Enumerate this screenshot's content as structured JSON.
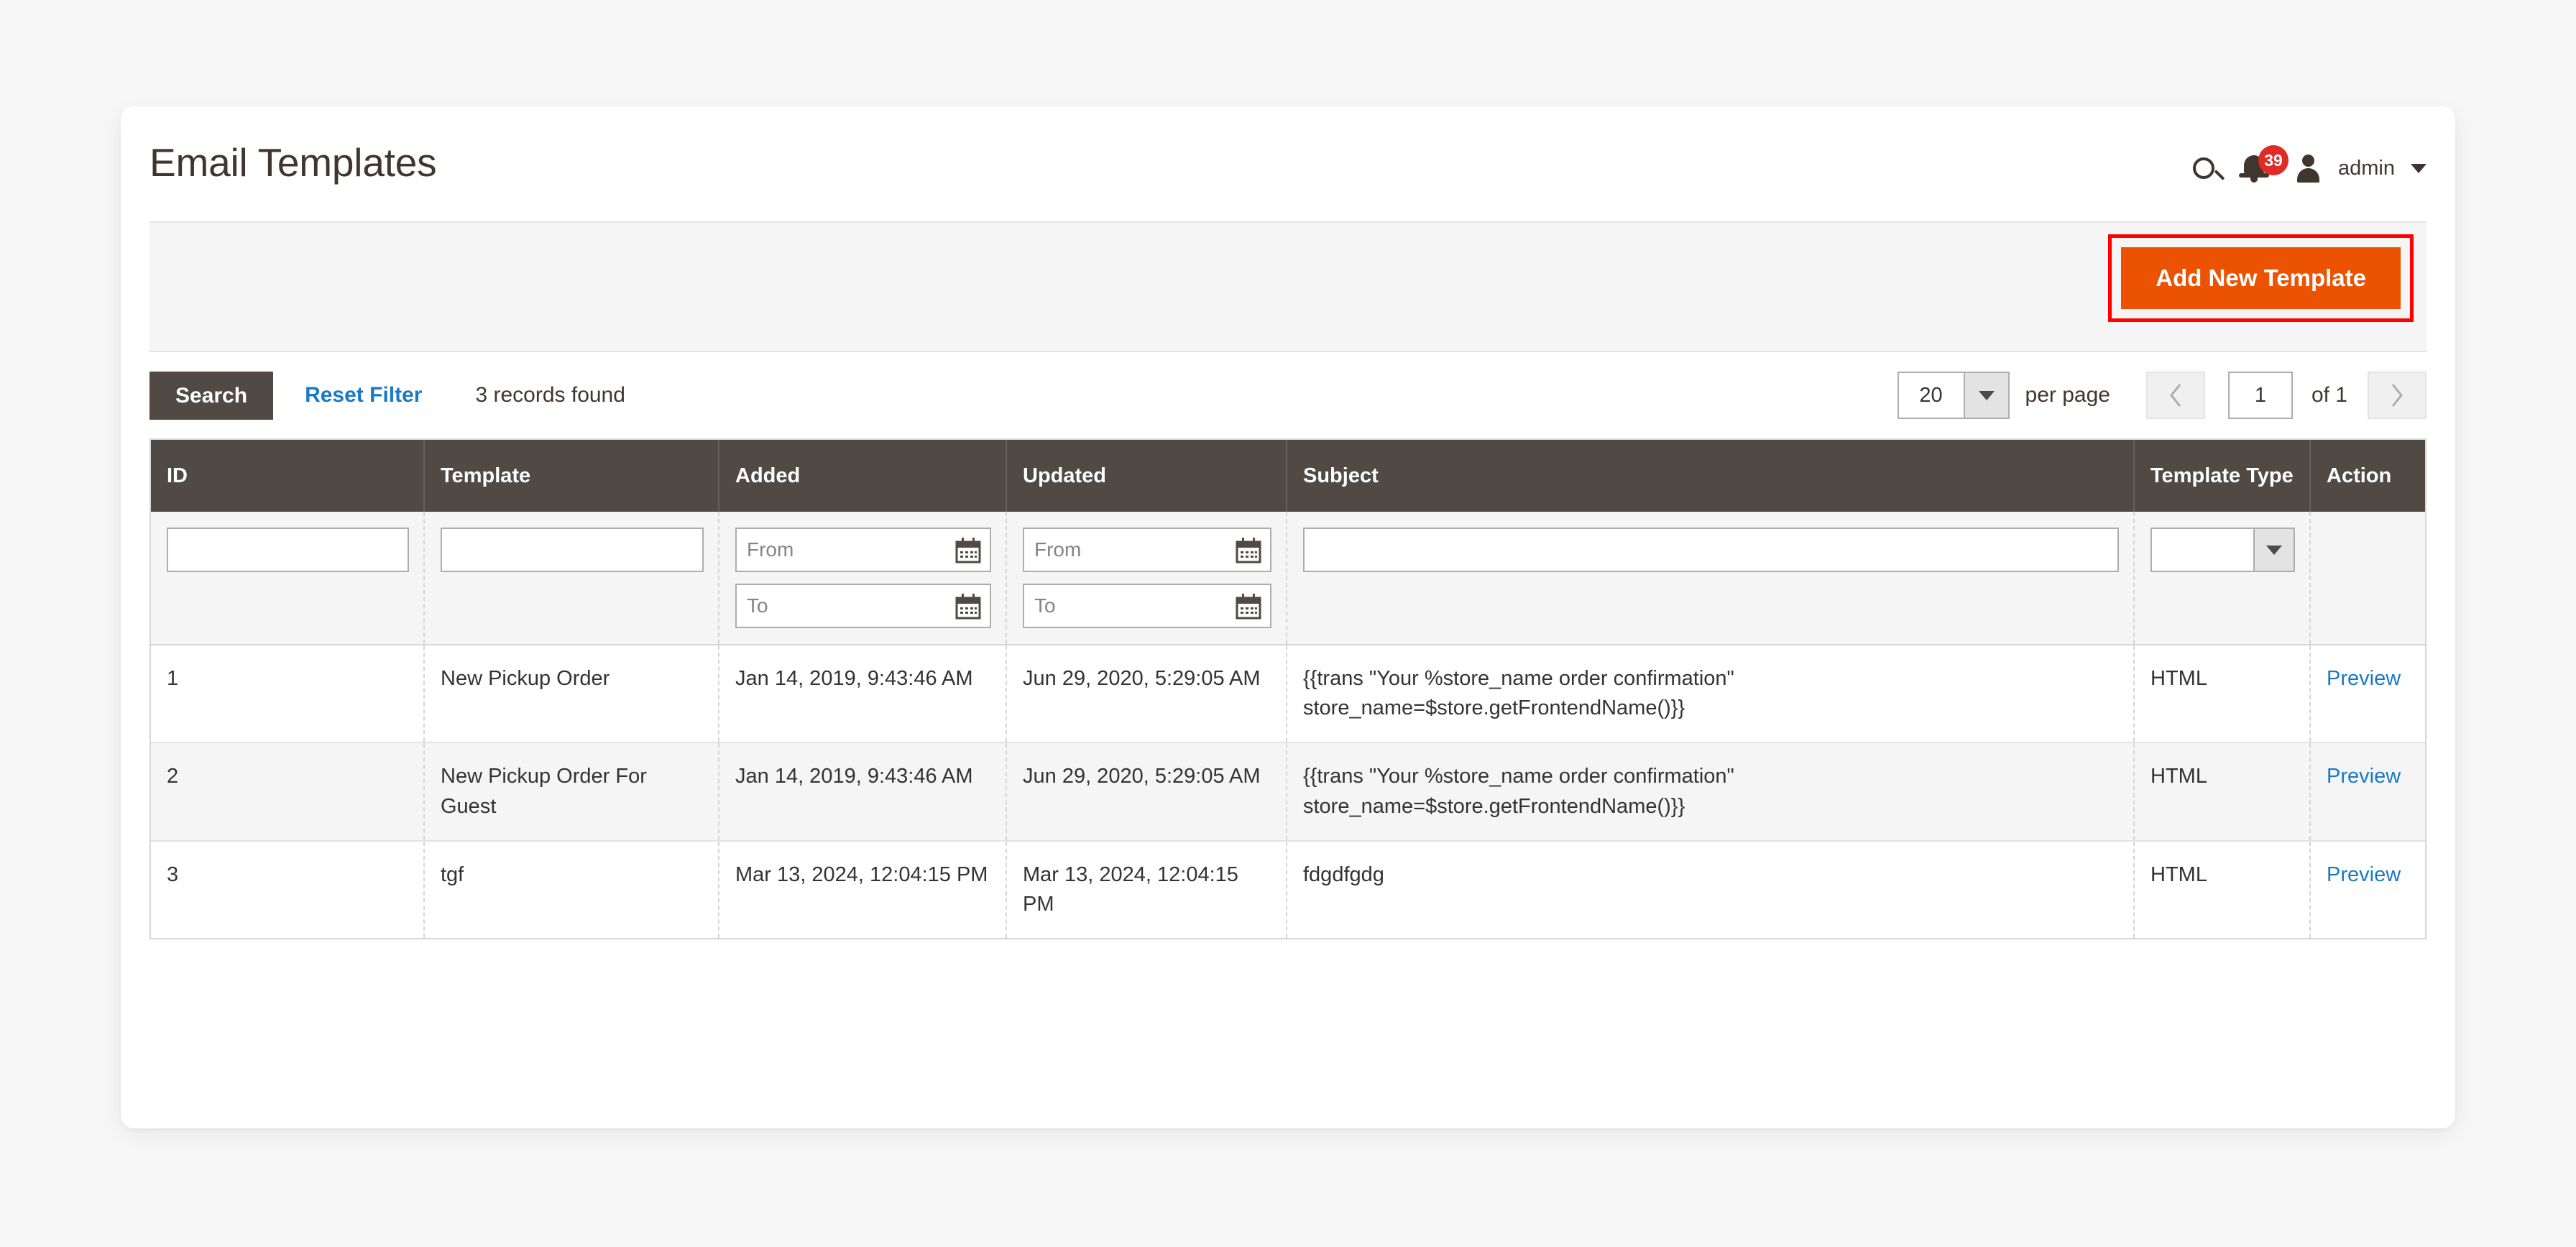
{
  "header": {
    "title": "Email Templates",
    "search_icon": "search-icon",
    "notifications": {
      "icon": "bell-icon",
      "count": "39"
    },
    "user": {
      "avatar_icon": "user-avatar-icon",
      "name": "admin",
      "caret_icon": "chevron-down-icon"
    }
  },
  "toolbar": {
    "add_new_template_label": "Add New Template",
    "accent_color": "#eb5202",
    "highlight_color": "#ff0000"
  },
  "grid_toolbar": {
    "search_label": "Search",
    "reset_filter_label": "Reset Filter",
    "records_found": "3 records found",
    "per_page_value": "20",
    "per_page_label": "per page",
    "prev_icon": "chevron-left-icon",
    "next_icon": "chevron-right-icon",
    "current_page": "1",
    "of_pages": "of 1"
  },
  "grid": {
    "columns": [
      {
        "key": "id",
        "label": "ID"
      },
      {
        "key": "template",
        "label": "Template"
      },
      {
        "key": "added",
        "label": "Added"
      },
      {
        "key": "updated",
        "label": "Updated"
      },
      {
        "key": "subject",
        "label": "Subject"
      },
      {
        "key": "type",
        "label": "Template Type"
      },
      {
        "key": "action",
        "label": "Action"
      }
    ],
    "filters": {
      "id": "",
      "template": "",
      "added_from_placeholder": "From",
      "added_to_placeholder": "To",
      "added_from": "",
      "added_to": "",
      "updated_from_placeholder": "From",
      "updated_to_placeholder": "To",
      "updated_from": "",
      "updated_to": "",
      "subject": "",
      "type": "",
      "calendar_icon": "calendar-icon",
      "dropdown_icon": "chevron-down-icon"
    },
    "rows": [
      {
        "id": "1",
        "template": "New Pickup Order",
        "added": "Jan 14, 2019, 9:43:46 AM",
        "updated": "Jun 29, 2020, 5:29:05 AM",
        "subject": "{{trans \"Your %store_name order confirmation\" store_name=$store.getFrontendName()}}",
        "type": "HTML",
        "action": "Preview"
      },
      {
        "id": "2",
        "template": "New Pickup Order For Guest",
        "added": "Jan 14, 2019, 9:43:46 AM",
        "updated": "Jun 29, 2020, 5:29:05 AM",
        "subject": "{{trans \"Your %store_name order confirmation\" store_name=$store.getFrontendName()}}",
        "type": "HTML",
        "action": "Preview"
      },
      {
        "id": "3",
        "template": "tgf",
        "added": "Mar 13, 2024, 12:04:15 PM",
        "updated": "Mar 13, 2024, 12:04:15 PM",
        "subject": "fdgdfgdg",
        "type": "HTML",
        "action": "Preview"
      }
    ]
  }
}
